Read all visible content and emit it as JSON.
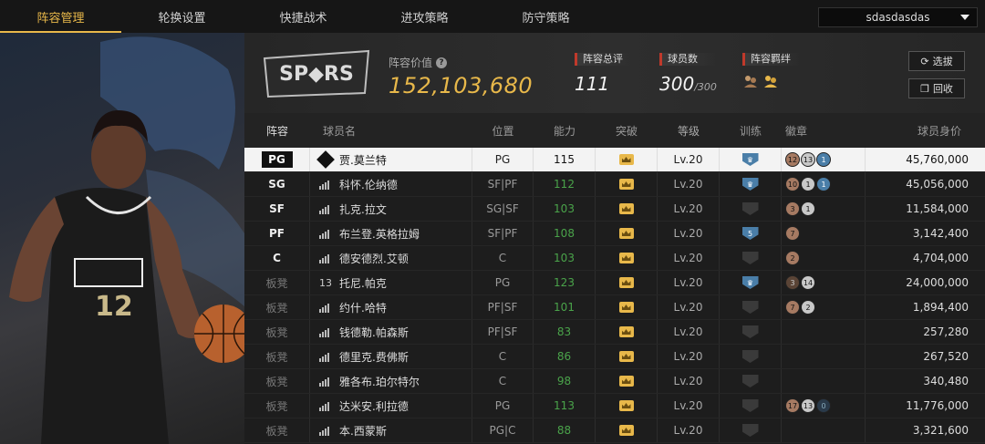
{
  "nav": {
    "tabs": [
      {
        "label": "阵容管理",
        "active": true
      },
      {
        "label": "轮换设置",
        "active": false
      },
      {
        "label": "快捷战术",
        "active": false
      },
      {
        "label": "进攻策略",
        "active": false
      },
      {
        "label": "防守策略",
        "active": false
      }
    ],
    "team_dropdown": "sdasdasdas"
  },
  "player_card": {
    "jersey_number": "12"
  },
  "header": {
    "value_label": "阵容价值",
    "value": "152,103,680",
    "rating_label": "阵容总评",
    "rating": "111",
    "count_label": "球员数",
    "count": "300",
    "count_max": "/300",
    "bond_label": "阵容羁绊",
    "select_button": "选拔",
    "recycle_button": "回收"
  },
  "table": {
    "headers": {
      "lineup": "阵容",
      "name": "球员名",
      "position": "位置",
      "overall": "能力",
      "breakthrough": "突破",
      "level": "等级",
      "training": "训练",
      "badge": "徽章",
      "price": "球员身价"
    },
    "rows": [
      {
        "lineup": "PG",
        "name": "贾.莫兰特",
        "position": "PG",
        "overall": "115",
        "level": "Lv.20",
        "price": "45,760,000",
        "icon": "diamond",
        "green": false,
        "train": "blue",
        "badges": [
          [
            "bronze",
            "12"
          ],
          [
            "silver",
            "13"
          ],
          [
            "blue",
            "1"
          ]
        ]
      },
      {
        "lineup": "SG",
        "name": "科怀.伦纳德",
        "position": "SF|PF",
        "overall": "112",
        "level": "Lv.20",
        "price": "45,056,000",
        "icon": "bars",
        "green": true,
        "train": "blue",
        "badges": [
          [
            "bronze",
            "10"
          ],
          [
            "silver",
            "1"
          ],
          [
            "blue",
            "1"
          ]
        ]
      },
      {
        "lineup": "SF",
        "name": "扎克.拉文",
        "position": "SG|SF",
        "overall": "103",
        "level": "Lv.20",
        "price": "11,584,000",
        "icon": "bars",
        "green": true,
        "train": "dark",
        "badges": [
          [
            "bronze",
            "3"
          ],
          [
            "silver",
            "1"
          ]
        ]
      },
      {
        "lineup": "PF",
        "name": "布兰登.英格拉姆",
        "position": "SF|PF",
        "overall": "108",
        "level": "Lv.20",
        "price": "3,142,400",
        "icon": "bars",
        "green": true,
        "train": "blue5",
        "badges": [
          [
            "bronze",
            "7"
          ]
        ]
      },
      {
        "lineup": "C",
        "name": "德安德烈.艾顿",
        "position": "C",
        "overall": "103",
        "level": "Lv.20",
        "price": "4,704,000",
        "icon": "bars",
        "green": true,
        "train": "dark",
        "badges": [
          [
            "bronze",
            "2"
          ]
        ]
      },
      {
        "lineup": "板凳",
        "name": "托尼.帕克",
        "position": "PG",
        "overall": "123",
        "level": "Lv.20",
        "price": "24,000,000",
        "icon": "13",
        "green": true,
        "train": "blue",
        "badges": [
          [
            "darkbronze",
            "3"
          ],
          [
            "silver",
            "14"
          ]
        ]
      },
      {
        "lineup": "板凳",
        "name": "约什.哈特",
        "position": "PF|SF",
        "overall": "101",
        "level": "Lv.20",
        "price": "1,894,400",
        "icon": "bars",
        "green": true,
        "train": "dark",
        "badges": [
          [
            "bronze",
            "7"
          ],
          [
            "silver",
            "2"
          ]
        ]
      },
      {
        "lineup": "板凳",
        "name": "钱德勒.帕森斯",
        "position": "PF|SF",
        "overall": "83",
        "level": "Lv.20",
        "price": "257,280",
        "icon": "bars",
        "green": true,
        "train": "dark",
        "badges": []
      },
      {
        "lineup": "板凳",
        "name": "德里克.费佛斯",
        "position": "C",
        "overall": "86",
        "level": "Lv.20",
        "price": "267,520",
        "icon": "bars",
        "green": true,
        "train": "dark",
        "badges": []
      },
      {
        "lineup": "板凳",
        "name": "雅各布.珀尔特尔",
        "position": "C",
        "overall": "98",
        "level": "Lv.20",
        "price": "340,480",
        "icon": "bars",
        "green": true,
        "train": "dark",
        "badges": []
      },
      {
        "lineup": "板凳",
        "name": "达米安.利拉德",
        "position": "PG",
        "overall": "113",
        "level": "Lv.20",
        "price": "11,776,000",
        "icon": "bars",
        "green": true,
        "train": "dark",
        "badges": [
          [
            "bronze",
            "17"
          ],
          [
            "silver",
            "13"
          ],
          [
            "dark",
            "0"
          ]
        ]
      },
      {
        "lineup": "板凳",
        "name": "本.西蒙斯",
        "position": "PG|C",
        "overall": "88",
        "level": "Lv.20",
        "price": "3,321,600",
        "icon": "bars",
        "green": true,
        "train": "dark",
        "badges": []
      }
    ]
  }
}
